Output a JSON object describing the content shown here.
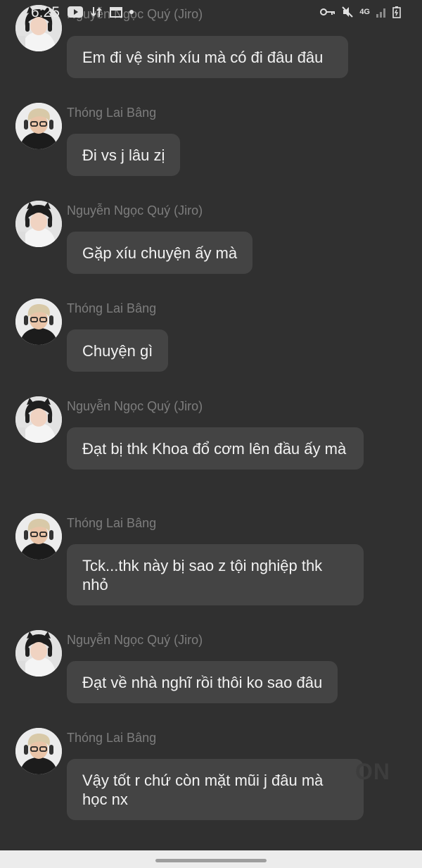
{
  "status_bar": {
    "time": "6:25",
    "network": "4G",
    "icons": [
      "youtube-icon",
      "transfer-icon",
      "calendar-icon",
      "dot-icon",
      "key-icon",
      "mute-icon",
      "signal-icon",
      "battery-icon"
    ]
  },
  "watermark": "ON",
  "messages": [
    {
      "sender": "Nguyễn Ngọc Quý (Jiro)",
      "text": "Em đi vệ sinh xíu mà có đi đâu đâu"
    },
    {
      "sender": "Thóng Lai Bâng",
      "text": "Đi vs j lâu zị"
    },
    {
      "sender": "Nguyễn Ngọc Quý (Jiro)",
      "text": "Gặp xíu chuyện ấy mà"
    },
    {
      "sender": "Thóng Lai Bâng",
      "text": "Chuyện gì"
    },
    {
      "sender": "Nguyễn Ngọc Quý (Jiro)",
      "text": "Đạt bị thk Khoa đổ cơm lên đầu ấy mà"
    },
    {
      "sender": "Thóng Lai Bâng",
      "text": "Tck...thk này bị sao z tội nghiệp thk nhỏ"
    },
    {
      "sender": "Nguyễn Ngọc Quý (Jiro)",
      "text": "Đạt về nhà nghĩ rồi thôi ko sao đâu"
    },
    {
      "sender": "Thóng Lai Bâng",
      "text": "Vậy tốt r chứ còn mặt mũi j đâu mà học nx"
    }
  ]
}
